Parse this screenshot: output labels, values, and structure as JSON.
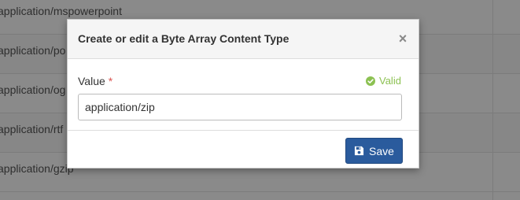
{
  "background_list": {
    "rows": [
      "application/mspowerpoint",
      "application/po",
      "application/og",
      "application/rtf",
      "application/gzip"
    ]
  },
  "modal": {
    "title": "Create or edit a Byte Array Content Type",
    "close_symbol": "×",
    "field": {
      "label": "Value",
      "required_mark": "*",
      "valid_text": "Valid",
      "value": "application/zip"
    },
    "save_label": "Save"
  },
  "colors": {
    "primary": "#2a5b9d",
    "valid": "#8cc152",
    "required": "#d9534f"
  },
  "icons": {
    "valid": "check-circle-icon",
    "save": "floppy-disk-icon",
    "close": "close-icon"
  }
}
